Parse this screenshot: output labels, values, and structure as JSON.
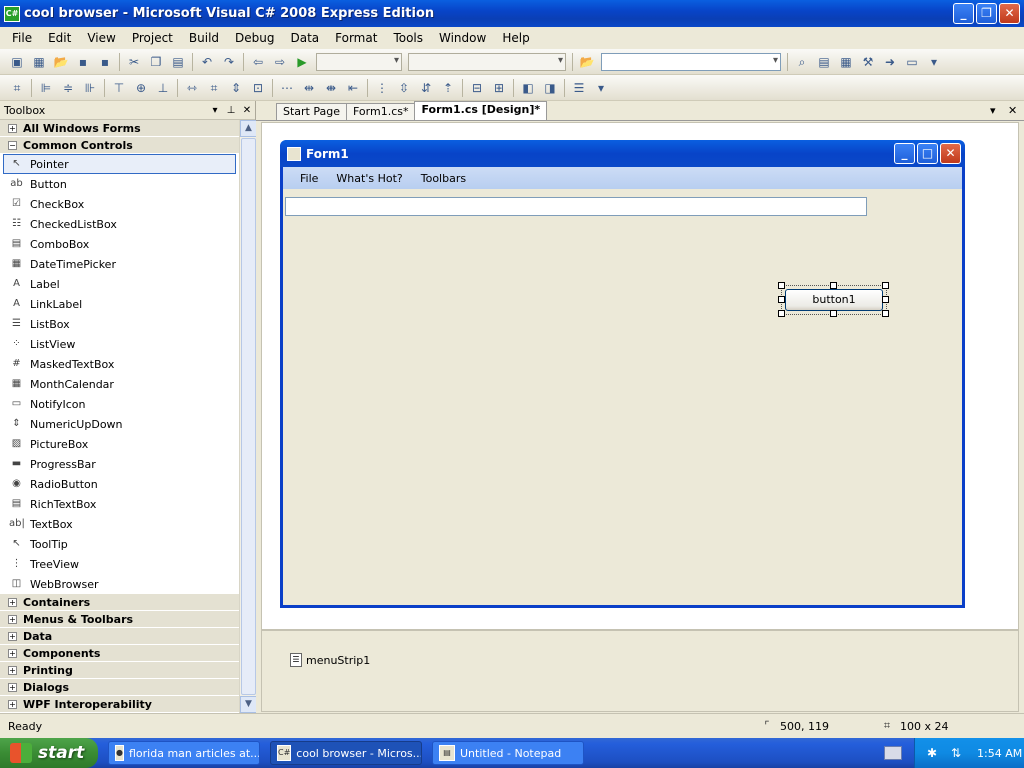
{
  "window": {
    "title": "cool browser - Microsoft Visual C# 2008 Express Edition",
    "app_icon": "C#"
  },
  "menubar": {
    "items": [
      "File",
      "Edit",
      "View",
      "Project",
      "Build",
      "Debug",
      "Data",
      "Format",
      "Tools",
      "Window",
      "Help"
    ]
  },
  "toolbox": {
    "title": "Toolbox",
    "categories_top": [
      {
        "label": "All Windows Forms",
        "expanded": false
      }
    ],
    "common_controls": {
      "label": "Common Controls",
      "expanded": true,
      "items": [
        {
          "label": "Pointer",
          "icon": "pointer-icon",
          "glyph": "↖",
          "selected": true
        },
        {
          "label": "Button",
          "icon": "button-icon",
          "glyph": "ab"
        },
        {
          "label": "CheckBox",
          "icon": "checkbox-icon",
          "glyph": "☑"
        },
        {
          "label": "CheckedListBox",
          "icon": "checkedlistbox-icon",
          "glyph": "☷"
        },
        {
          "label": "ComboBox",
          "icon": "combobox-icon",
          "glyph": "▤"
        },
        {
          "label": "DateTimePicker",
          "icon": "datetimepicker-icon",
          "glyph": "▦"
        },
        {
          "label": "Label",
          "icon": "label-icon",
          "glyph": "A"
        },
        {
          "label": "LinkLabel",
          "icon": "linklabel-icon",
          "glyph": "A"
        },
        {
          "label": "ListBox",
          "icon": "listbox-icon",
          "glyph": "☰"
        },
        {
          "label": "ListView",
          "icon": "listview-icon",
          "glyph": "⁘"
        },
        {
          "label": "MaskedTextBox",
          "icon": "maskedtextbox-icon",
          "glyph": "#"
        },
        {
          "label": "MonthCalendar",
          "icon": "monthcalendar-icon",
          "glyph": "▦"
        },
        {
          "label": "NotifyIcon",
          "icon": "notifyicon-icon",
          "glyph": "▭"
        },
        {
          "label": "NumericUpDown",
          "icon": "numericupdown-icon",
          "glyph": "⇕"
        },
        {
          "label": "PictureBox",
          "icon": "picturebox-icon",
          "glyph": "▨"
        },
        {
          "label": "ProgressBar",
          "icon": "progressbar-icon",
          "glyph": "▬"
        },
        {
          "label": "RadioButton",
          "icon": "radiobutton-icon",
          "glyph": "◉"
        },
        {
          "label": "RichTextBox",
          "icon": "richtextbox-icon",
          "glyph": "▤"
        },
        {
          "label": "TextBox",
          "icon": "textbox-icon",
          "glyph": "ab|"
        },
        {
          "label": "ToolTip",
          "icon": "tooltip-icon",
          "glyph": "↖"
        },
        {
          "label": "TreeView",
          "icon": "treeview-icon",
          "glyph": "⋮"
        },
        {
          "label": "WebBrowser",
          "icon": "webbrowser-icon",
          "glyph": "◫"
        }
      ]
    },
    "categories_bottom": [
      {
        "label": "Containers"
      },
      {
        "label": "Menus & Toolbars"
      },
      {
        "label": "Data"
      },
      {
        "label": "Components"
      },
      {
        "label": "Printing"
      },
      {
        "label": "Dialogs"
      },
      {
        "label": "WPF Interoperability"
      }
    ]
  },
  "tabs": [
    {
      "label": "Start Page",
      "active": false
    },
    {
      "label": "Form1.cs*",
      "active": false
    },
    {
      "label": "Form1.cs [Design]*",
      "active": true
    }
  ],
  "form1": {
    "title": "Form1",
    "menu": [
      "File",
      "What's Hot?",
      "Toolbars"
    ],
    "textbox_value": "",
    "button_label": "button1"
  },
  "component_tray": {
    "items": [
      {
        "label": "menuStrip1",
        "icon": "menustrip-icon"
      }
    ]
  },
  "statusbar": {
    "status": "Ready",
    "position": "500, 119",
    "size": "100 x 24"
  },
  "taskbar": {
    "start_label": "start",
    "tasks": [
      {
        "label": "florida man articles at...",
        "icon": "firefox-icon",
        "active": false
      },
      {
        "label": "cool browser - Micros...",
        "icon": "visual-studio-icon",
        "active": true
      },
      {
        "label": "Untitled - Notepad",
        "icon": "notepad-icon",
        "active": false
      }
    ],
    "clock": "1:54 AM"
  },
  "colors": {
    "xp_blue": "#0a48c8",
    "start_green": "#3a8c34",
    "selection": "#316ac5"
  }
}
